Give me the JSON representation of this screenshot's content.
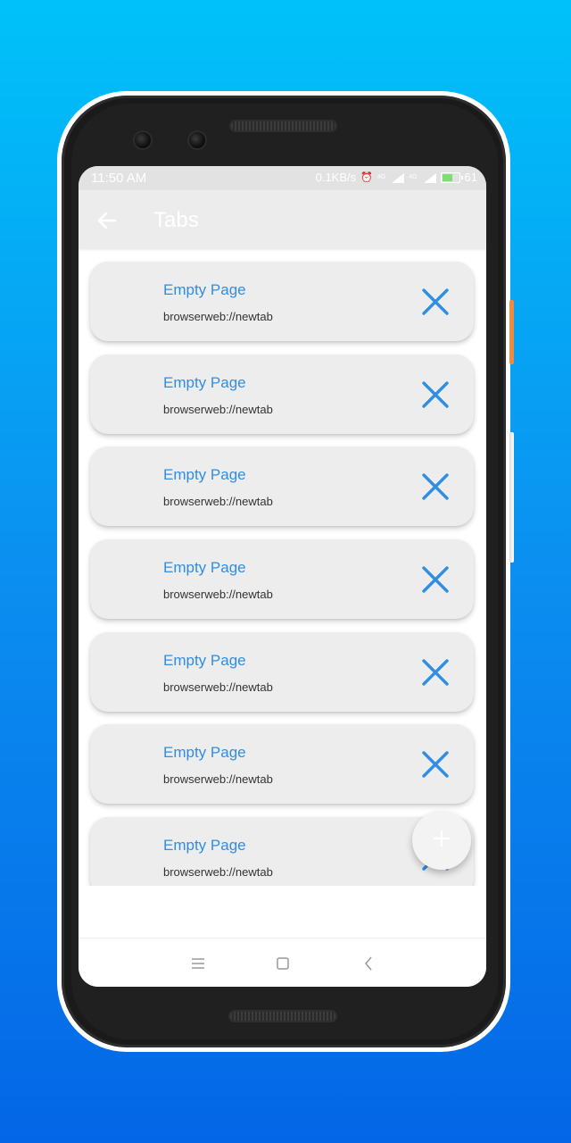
{
  "status_bar": {
    "time": "11:50 AM",
    "net_speed": "0.1KB/s",
    "network_1": "4G",
    "network_2": "4G",
    "battery_percent": "61",
    "battery_color": "#7be06d"
  },
  "app_bar": {
    "back_icon": "arrow-left-icon",
    "title": "Tabs"
  },
  "tabs": [
    {
      "title": "Empty Page",
      "url": "browserweb://newtab"
    },
    {
      "title": "Empty Page",
      "url": "browserweb://newtab"
    },
    {
      "title": "Empty Page",
      "url": "browserweb://newtab"
    },
    {
      "title": "Empty Page",
      "url": "browserweb://newtab"
    },
    {
      "title": "Empty Page",
      "url": "browserweb://newtab"
    },
    {
      "title": "Empty Page",
      "url": "browserweb://newtab"
    },
    {
      "title": "Empty Page",
      "url": "browserweb://newtab"
    }
  ],
  "fab": {
    "icon": "plus-icon"
  },
  "nav_bar": {
    "items": [
      "menu-icon",
      "home-square-icon",
      "back-chevron-icon"
    ]
  },
  "colors": {
    "accent": "#2f8ee3",
    "background_top": "#00c2f9",
    "background_bottom": "#0466e6",
    "card": "#ededed",
    "app_bar": "#ececec"
  }
}
